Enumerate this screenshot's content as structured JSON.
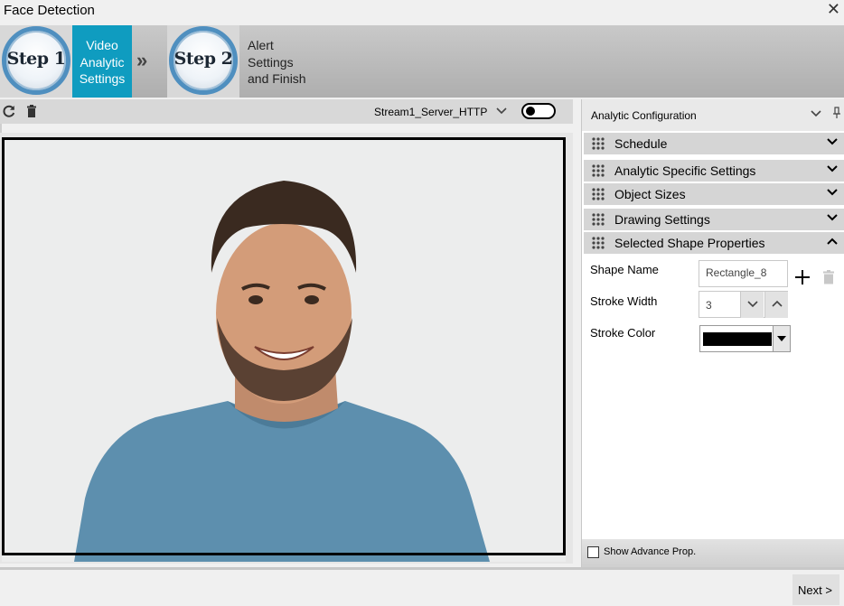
{
  "window": {
    "title": "Face Detection",
    "close_glyph": "✕"
  },
  "steps": {
    "step1": {
      "badge": "Step 1",
      "label_lines": [
        "Video",
        "Analytic",
        "Settings"
      ]
    },
    "separator": "»",
    "step2": {
      "badge": "Step 2",
      "label_lines": [
        "Alert",
        "Settings",
        "and Finish"
      ]
    }
  },
  "viewer_toolbar": {
    "stream": "Stream1_Server_HTTP",
    "refresh_icon": "refresh-icon",
    "delete_icon": "trash-icon"
  },
  "panel": {
    "title": "Analytic Configuration",
    "sections": [
      {
        "label": "Schedule",
        "expanded": false
      },
      {
        "label": "Analytic Specific Settings",
        "expanded": false
      },
      {
        "label": "Object Sizes",
        "expanded": false
      },
      {
        "label": "Drawing Settings",
        "expanded": false
      },
      {
        "label": "Selected Shape Properties",
        "expanded": true
      }
    ],
    "props": {
      "shape_name_label": "Shape Name",
      "shape_name_value": "Rectangle_8",
      "stroke_width_label": "Stroke Width",
      "stroke_width_value": "3",
      "stroke_color_label": "Stroke Color",
      "stroke_color": "#000000"
    },
    "footer": {
      "show_advance": "Show Advance Prop."
    }
  },
  "footer": {
    "next": "Next >"
  },
  "colors": {
    "accent": "#0f9cc0",
    "step_ring": "#4f8fbf"
  }
}
